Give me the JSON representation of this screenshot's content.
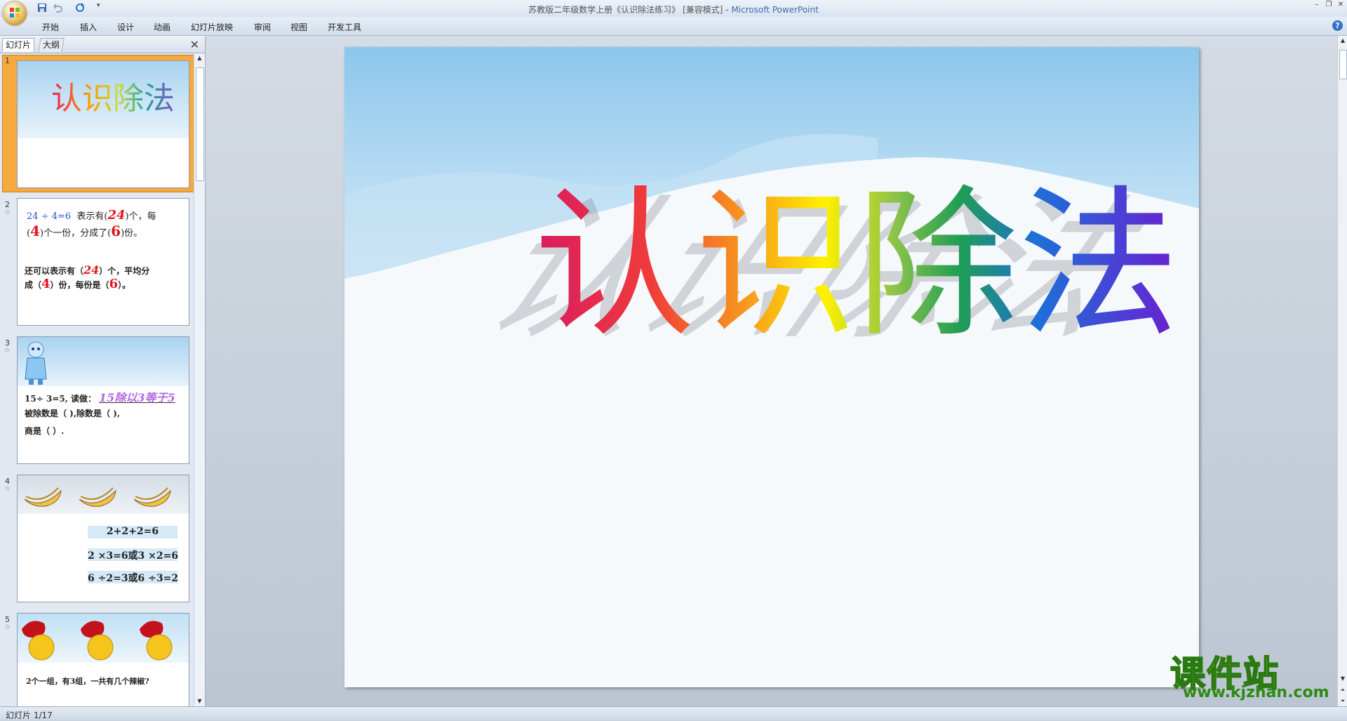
{
  "window": {
    "title_doc": "苏教版二年级数学上册《认识除法练习》 [兼容模式]",
    "title_sep": " - ",
    "title_app": "Microsoft PowerPoint"
  },
  "ribbon": {
    "tabs": [
      "开始",
      "插入",
      "设计",
      "动画",
      "幻灯片放映",
      "审阅",
      "视图",
      "开发工具"
    ]
  },
  "panel": {
    "tab_slides": "幻灯片",
    "tab_outline": "大纲"
  },
  "thumbnails": [
    {
      "number": "1",
      "title": "认识除法"
    },
    {
      "number": "2",
      "line1_a": "24 ÷ 4=6",
      "line1_b": "表示有(",
      "line1_v": "24",
      "line1_c": ")个，每",
      "line2_a": "(",
      "line2_v1": "4",
      "line2_b": ")个一份，分成了(",
      "line2_v2": "6",
      "line2_c": ")份。",
      "line3_a": "还可以表示有（",
      "line3_v": "24",
      "line3_b": "）个，平均分",
      "line4_a": "成（",
      "line4_v1": "4",
      "line4_b": "）份，每份是（",
      "line4_v2": "6",
      "line4_c": "）。"
    },
    {
      "number": "3",
      "line1": "15÷ 3=5, 读做：",
      "answer": "15除以3等于5",
      "line2": "被除数是（  ),除数是（  ),",
      "line3": "商是（  ）."
    },
    {
      "number": "4",
      "eq1": "2+2+2=6",
      "eq2": "2 ×3=6或3 ×2=6",
      "eq3": "6 ÷2=3或6 ÷3=2"
    },
    {
      "number": "5",
      "caption": "2个一组，有3组，一共有几个辣椒?"
    }
  ],
  "slide": {
    "title_chars": [
      "认",
      "识",
      "除",
      "法"
    ],
    "title_colors": [
      "#d81b60",
      "#f7931e",
      "#8bc34a",
      "#5a2fd6"
    ]
  },
  "status": {
    "text": "幻灯片 1/17"
  },
  "watermark": {
    "title": "课件站",
    "url": "www.kjzhan.com"
  }
}
